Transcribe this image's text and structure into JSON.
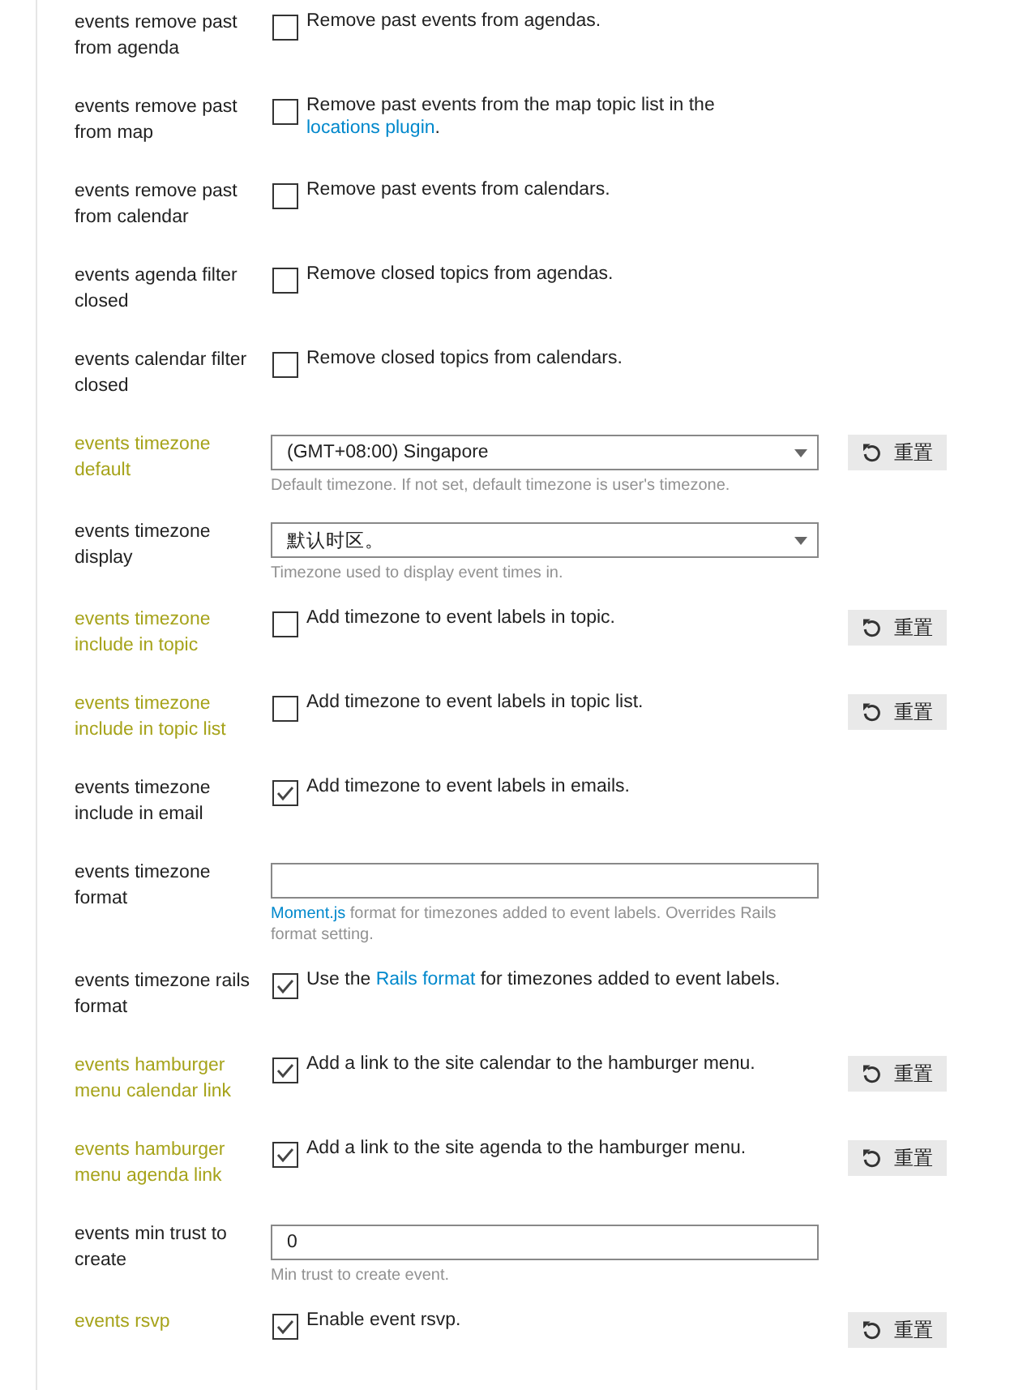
{
  "settings": [
    {
      "label": "events remove past from agenda",
      "overridden": false,
      "kind": "checkbox",
      "checked": false,
      "description": [
        {
          "kind": "text",
          "text": "Remove past events from agendas."
        }
      ]
    },
    {
      "label": "events remove past from map",
      "overridden": false,
      "kind": "checkbox",
      "checked": false,
      "description": [
        {
          "kind": "text",
          "text": "Remove past events from the map topic list in the "
        },
        {
          "kind": "link",
          "text": "locations plugin"
        },
        {
          "kind": "text",
          "text": "."
        }
      ]
    },
    {
      "label": "events remove past from calendar",
      "overridden": false,
      "kind": "checkbox",
      "checked": false,
      "description": [
        {
          "kind": "text",
          "text": "Remove past events from calendars."
        }
      ]
    },
    {
      "label": "events agenda filter closed",
      "overridden": false,
      "kind": "checkbox",
      "checked": false,
      "description": [
        {
          "kind": "text",
          "text": "Remove closed topics from agendas."
        }
      ]
    },
    {
      "label": "events calendar filter closed",
      "overridden": false,
      "kind": "checkbox",
      "checked": false,
      "description": [
        {
          "kind": "text",
          "text": "Remove closed topics from calendars."
        }
      ]
    },
    {
      "label": "events timezone default",
      "overridden": true,
      "kind": "select",
      "value": "(GMT+08:00) Singapore",
      "description": [
        {
          "kind": "text",
          "text": "Default timezone. If not set, default timezone is user's timezone."
        }
      ],
      "reset_button": "重置"
    },
    {
      "label": "events timezone display",
      "overridden": false,
      "kind": "select",
      "value": "默认时区。",
      "description": [
        {
          "kind": "text",
          "text": "Timezone used to display event times in."
        }
      ]
    },
    {
      "label": "events timezone include in topic",
      "overridden": true,
      "kind": "checkbox",
      "checked": false,
      "description": [
        {
          "kind": "text",
          "text": "Add timezone to event labels in topic."
        }
      ],
      "reset_button": "重置"
    },
    {
      "label": "events timezone include in topic list",
      "overridden": true,
      "kind": "checkbox",
      "checked": false,
      "description": [
        {
          "kind": "text",
          "text": "Add timezone to event labels in topic list."
        }
      ],
      "reset_button": "重置"
    },
    {
      "label": "events timezone include in email",
      "overridden": false,
      "kind": "checkbox",
      "checked": true,
      "description": [
        {
          "kind": "text",
          "text": "Add timezone to event labels in emails."
        }
      ]
    },
    {
      "label": "events timezone format",
      "overridden": false,
      "kind": "text",
      "description": [
        {
          "kind": "link",
          "text": "Moment.js"
        },
        {
          "kind": "text",
          "text": " format for timezones added to event labels. Overrides Rails format setting."
        }
      ]
    },
    {
      "label": "events timezone rails format",
      "overridden": false,
      "kind": "checkbox",
      "checked": true,
      "description": [
        {
          "kind": "text",
          "text": "Use the "
        },
        {
          "kind": "link",
          "text": "Rails format"
        },
        {
          "kind": "text",
          "text": " for timezones added to event labels."
        }
      ]
    },
    {
      "label": "events hamburger menu calendar link",
      "overridden": true,
      "kind": "checkbox",
      "checked": true,
      "description": [
        {
          "kind": "text",
          "text": "Add a link to the site calendar to the hamburger menu."
        }
      ],
      "reset_button": "重置"
    },
    {
      "label": "events hamburger menu agenda link",
      "overridden": true,
      "kind": "checkbox",
      "checked": true,
      "description": [
        {
          "kind": "text",
          "text": "Add a link to the site agenda to the hamburger menu."
        }
      ],
      "reset_button": "重置"
    },
    {
      "label": "events min trust to create",
      "overridden": false,
      "kind": "text",
      "value": "0",
      "description": [
        {
          "kind": "text",
          "text": "Min trust to create event."
        }
      ]
    },
    {
      "label": "events rsvp",
      "overridden": true,
      "kind": "checkbox",
      "checked": true,
      "description": [
        {
          "kind": "text",
          "text": "Enable event rsvp."
        }
      ],
      "reset_button": "重置"
    }
  ]
}
